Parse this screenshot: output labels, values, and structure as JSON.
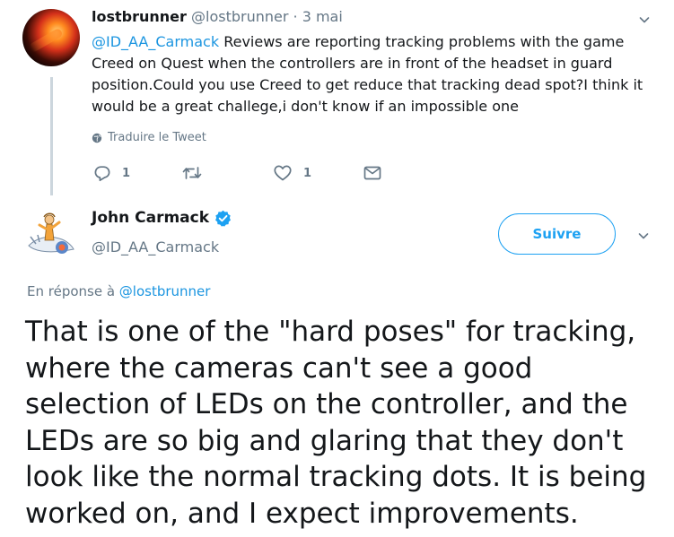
{
  "reply_tweet": {
    "author_name": "lostbrunner",
    "handle": "@lostbrunner",
    "separator": "·",
    "time": "3 mai",
    "mention": "@ID_AA_Carmack",
    "text": " Reviews are reporting tracking problems with the game Creed on Quest when the controllers are in front of the headset in guard position.Could you use Creed to get reduce that tracking dead spot?I think it would be a great challege,i don't know if an impossible one",
    "translate_label": "Traduire le Tweet",
    "reply_count": "1",
    "like_count": "1"
  },
  "main_tweet": {
    "author_name": "John Carmack",
    "handle": "@ID_AA_Carmack",
    "follow_label": "Suivre",
    "reply_prefix": "En réponse à ",
    "reply_to": "@lostbrunner",
    "text": "That is one of the \"hard poses\" for tracking, where the cameras can't see a good selection of LEDs on the controller, and the LEDs are so big and glaring that they don't look like the normal tracking dots.  It is being worked on, and I expect improvements."
  },
  "icons": {
    "verified": "verified-badge-icon",
    "caret": "chevron-down-icon",
    "globe": "globe-icon",
    "reply": "reply-icon",
    "retweet": "retweet-icon",
    "like": "heart-icon",
    "message": "envelope-icon"
  },
  "colors": {
    "accent": "#1da1f2",
    "link": "#1b95e0",
    "secondary_text": "#657786",
    "thread_line": "#ccd6dd"
  }
}
